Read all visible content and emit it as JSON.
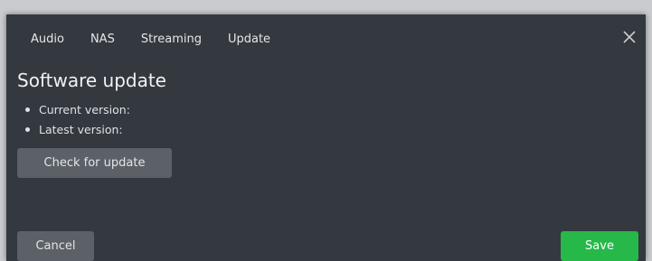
{
  "tabs": [
    {
      "label": "Audio"
    },
    {
      "label": "NAS"
    },
    {
      "label": "Streaming"
    },
    {
      "label": "Update"
    }
  ],
  "close_icon": "close-icon",
  "section": {
    "title": "Software update",
    "current_version_label": "Current version:",
    "latest_version_label": "Latest version:"
  },
  "buttons": {
    "check_for_update": "Check for update",
    "cancel": "Cancel",
    "save": "Save"
  },
  "colors": {
    "background": "#34383f",
    "button_secondary": "#5c6168",
    "button_primary": "#27b84a"
  }
}
